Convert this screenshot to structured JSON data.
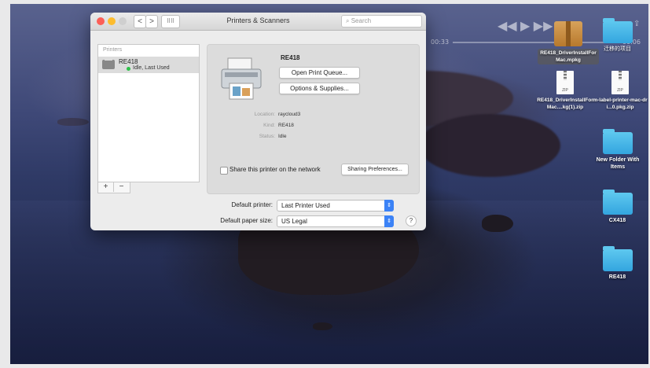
{
  "media": {
    "controls": "◀◀  ▶  ▶▶",
    "time_elapsed": "00:33",
    "time_remaining": "-00:06",
    "download_icon": "download-icon"
  },
  "window": {
    "title": "Printers & Scanners",
    "search_placeholder": "Search",
    "nav_back": "<",
    "nav_forward": ">",
    "grid_label": "⠿⠿"
  },
  "printers_list": {
    "header": "Printers",
    "items": [
      {
        "name": "RE418",
        "status": "Idle, Last Used"
      }
    ],
    "add_label": "+",
    "remove_label": "−"
  },
  "detail": {
    "printer_name": "RE418",
    "open_queue_label": "Open Print Queue...",
    "options_label": "Options & Supplies...",
    "location_key": "Location:",
    "location_value": "raycloud3",
    "kind_key": "Kind:",
    "kind_value": "RE418",
    "status_key": "Status:",
    "status_value": "Idle",
    "share_label": "Share this printer on the network",
    "sharing_prefs_label": "Sharing Preferences..."
  },
  "defaults": {
    "default_printer_label": "Default printer:",
    "default_printer_value": "Last Printer Used",
    "paper_size_label": "Default paper size:",
    "paper_size_value": "US Legal",
    "help_label": "?"
  },
  "desktop": {
    "icons": [
      {
        "label": "迁移的项目",
        "type": "folder"
      },
      {
        "label": "RE418_DriverInstallForMac.mpkg",
        "type": "package"
      },
      {
        "label": "RE418_DriverInstallForMac....kg(1).zip",
        "type": "zip"
      },
      {
        "label": "m-label-printer-mac-dri...0.pkg.zip",
        "type": "zip"
      },
      {
        "label": "New Folder With Items",
        "type": "folder"
      },
      {
        "label": "CX418",
        "type": "folder"
      },
      {
        "label": "RE418",
        "type": "folder"
      }
    ],
    "zip_badge": "ZIP"
  }
}
